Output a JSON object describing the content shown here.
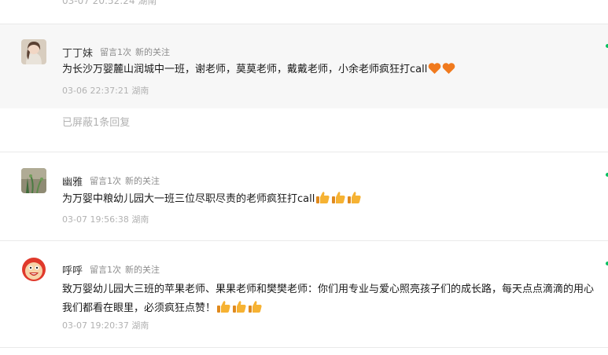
{
  "top_meta": "03-07 20:52:24 湖南",
  "comments": [
    {
      "nickname": "丁丁妹",
      "tag_count": "留言1次",
      "tag_new": "新的关注",
      "text": "为长沙万婴麓山润城中一班，谢老师，莫莫老师，戴戴老师，小余老师疯狂打call",
      "emoji": [
        "heart-icon",
        "heart-icon"
      ],
      "meta": "03-06 22:37:21 湖南",
      "hidden_reply": "已屏蔽1条回复",
      "avatar": "avatar-girl"
    },
    {
      "nickname": "幽雅",
      "tag_count": "留言1次",
      "tag_new": "新的关注",
      "text": "为万婴中粮幼儿园大一班三位尽职尽责的老师疯狂打call",
      "emoji": [
        "thumbs-up-icon",
        "thumbs-up-icon",
        "thumbs-up-icon"
      ],
      "meta": "03-07 19:56:38 湖南",
      "avatar": "avatar-plant"
    },
    {
      "nickname": "呼呼",
      "tag_count": "留言1次",
      "tag_new": "新的关注",
      "text": "致万婴幼儿园大三班的苹果老师、果果老师和樊樊老师：你们用专业与爱心照亮孩子们的成长路，每天点点滴滴的用心我们都看在眼里，必须疯狂点赞！",
      "emoji": [
        "thumbs-up-icon",
        "thumbs-up-icon",
        "thumbs-up-icon"
      ],
      "meta": "03-07 19:20:37 湖南",
      "avatar": "avatar-cartoon"
    }
  ],
  "colors": {
    "nickname": "#353535",
    "tag": "#8c8c8c",
    "meta": "#b2b2b2",
    "highlight_bg": "#f7f7f7",
    "accent": "#07c160"
  }
}
